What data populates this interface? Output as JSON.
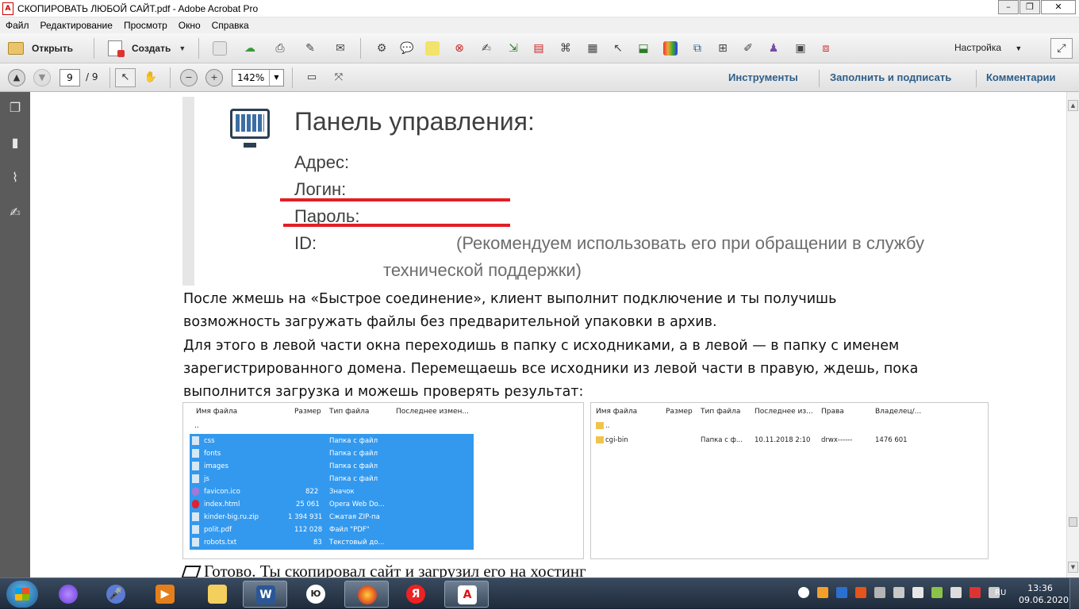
{
  "window": {
    "title": "СКОПИРОВАТЬ ЛЮБОЙ САЙТ.pdf - Adobe Acrobat Pro",
    "app_icon": "pdf-icon",
    "minimize": "–",
    "restore": "❐",
    "close": "✕"
  },
  "menu": [
    "Файл",
    "Редактирование",
    "Просмотр",
    "Окно",
    "Справка"
  ],
  "toolbar": {
    "open_label": "Открыть",
    "create_label": "Создать",
    "customize_label": "Настройка"
  },
  "nav": {
    "page_current": "9",
    "page_total": "/ 9",
    "zoom": "142%",
    "tools": "Инструменты",
    "fill_sign": "Заполнить и подписать",
    "comments": "Комментарии"
  },
  "document": {
    "panel": {
      "title": "Панель управления:",
      "address": "Адрес:",
      "login": "Логин:",
      "password": "Пароль:",
      "id": "ID:",
      "note_line1": "(Рекомендуем использовать его при обращении в службу",
      "note_line2": "технической поддержки)"
    },
    "paragraphs": [
      "После жмешь на «Быстрое соединение», клиент выполнит подключение и ты получишь",
      "возможность загружать файлы без предварительной упаковки в архив.",
      "Для этого в левой части окна переходишь в папку с исходниками, а в левой — в папку с именем",
      "зарегистрированного домена. Перемещаешь все исходники из левой части в правую, ждешь, пока",
      "выполнится загрузка и можешь проверять результат:"
    ],
    "left_pane": {
      "headers": [
        "Имя файла",
        "Размер",
        "Тип файла",
        "Последнее измен..."
      ],
      "parent": "..",
      "rows": [
        {
          "name": "css",
          "size": "",
          "type": "Папка с файл"
        },
        {
          "name": "fonts",
          "size": "",
          "type": "Папка с файл"
        },
        {
          "name": "images",
          "size": "",
          "type": "Папка с файл"
        },
        {
          "name": "js",
          "size": "",
          "type": "Папка с файл"
        },
        {
          "name": "favicon.ico",
          "size": "822",
          "type": "Значок"
        },
        {
          "name": "index.html",
          "size": "25 061",
          "type": "Opera Web Do..."
        },
        {
          "name": "kinder-big.ru.zip",
          "size": "1 394 931",
          "type": "Сжатая ZIP-па"
        },
        {
          "name": "polit.pdf",
          "size": "112 028",
          "type": "Файл \"PDF\""
        },
        {
          "name": "robots.txt",
          "size": "83",
          "type": "Текстовый до..."
        }
      ]
    },
    "right_pane": {
      "headers": [
        "Имя файла",
        "Размер",
        "Тип файла",
        "Последнее из...",
        "Права",
        "Владелец/..."
      ],
      "parent": "..",
      "row": {
        "name": "cgi-bin",
        "type": "Папка с ф...",
        "modified": "10.11.2018 2:10",
        "perms": "drwx------",
        "owner": "1476 601"
      }
    },
    "last_line": "Готово. Ты скопировал сайт и загрузил его на хостинг"
  },
  "taskbar": {
    "tray_lang": "RU",
    "time": "13:36",
    "date": "09.06.2020"
  },
  "colors": {
    "link": "#2d5e8a",
    "underline_red": "#e21f26",
    "selection": "#3399ee"
  }
}
